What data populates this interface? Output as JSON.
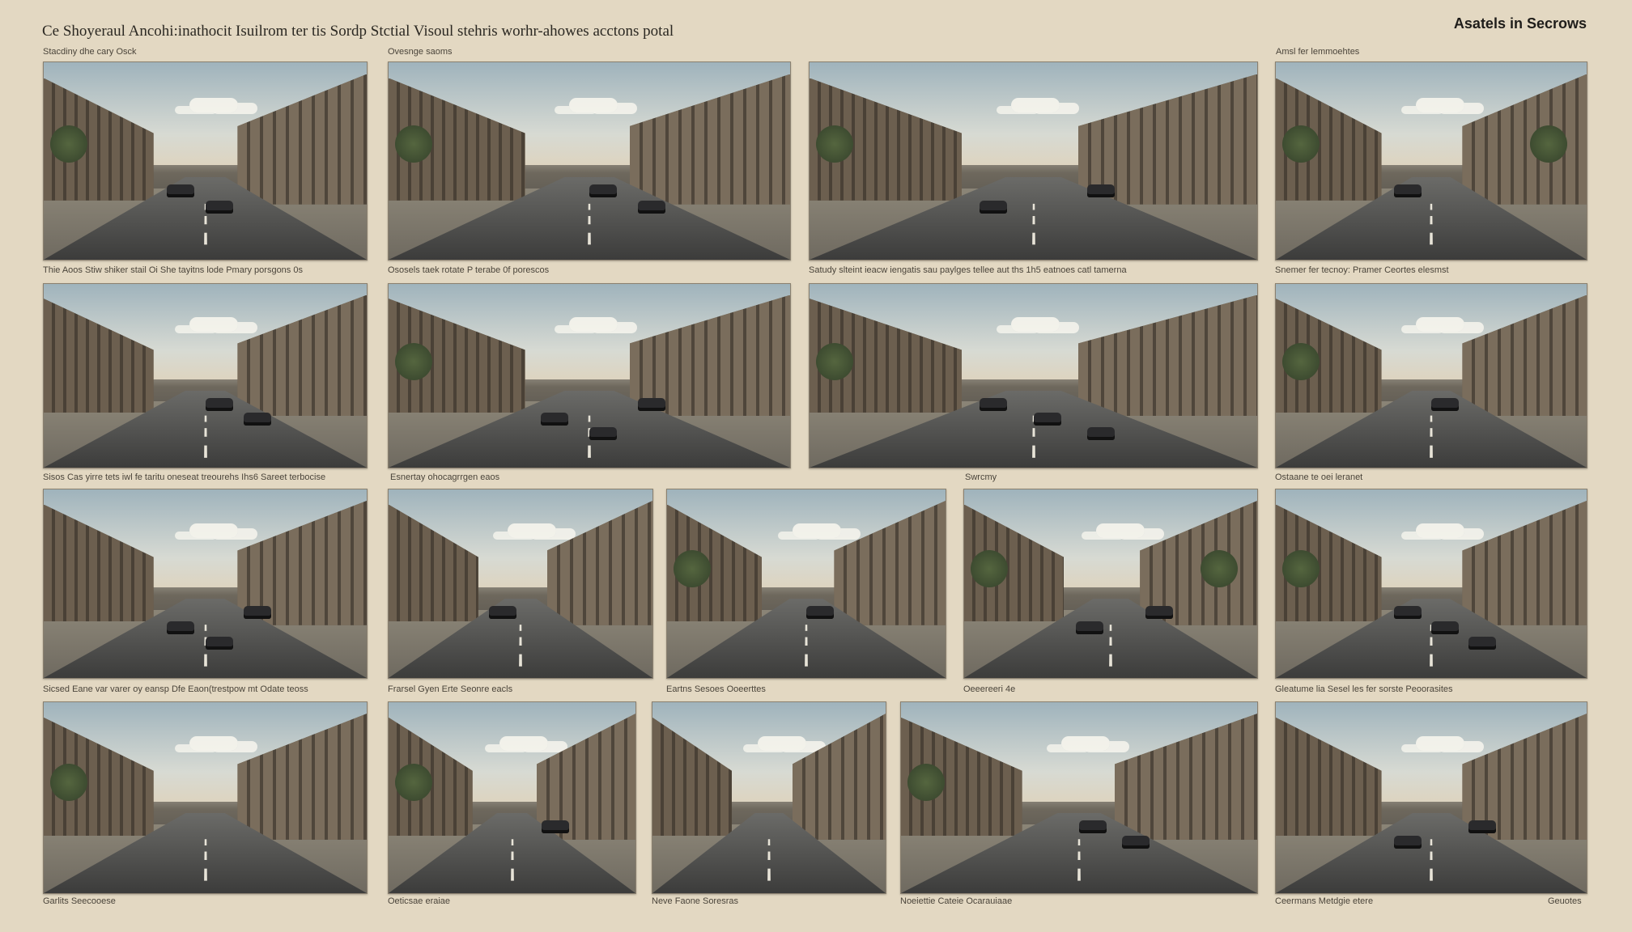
{
  "header": {
    "title": "Ce Shoyeraul Ancohi:inathocit Isuilrom ter tis Sordp Stctial Visoul stehris worhr-ahowes acctons potal",
    "brand": "Asatels in Secrows"
  },
  "captions": {
    "r1c1_top": "Stacdiny dhe cary Osck",
    "r1c2_top": "Ovesnge saoms",
    "r1c4_top": "Amsl fer lemmoehtes",
    "r1c1": "Thie Aoos Stiw shiker stail Oi She tayitns lode Pmary porsgons 0s",
    "r1c2": "Ososels taek rotate P terabe 0f porescos",
    "r1c3": "Satudy slteint ieacw iengatis sau paylges tellee aut ths 1h5 eatnoes catl tamerna",
    "r1c4": "Snemer fer tecnoy: Pramer Ceortes elesmst",
    "r2c1": "Sisos Cas yirre tets iwl fe taritu oneseat treourehs Ihs6 Sareet terbocise",
    "r2c2": "Esnertay ohocagrrgen eaos",
    "r2c3": "Swrcmy",
    "r2c4": "Ostaane te oei leranet",
    "r3c1": "Sicsed Eane var varer oy eansp Dfe Eaon(trestpow mt Odate teoss",
    "r3c2": "Frarsel Gyen Erte Seonre eacls",
    "r3c3": "Eartns Sesoes Ooeerttes",
    "r3c4": "Oeeereeri 4e",
    "r3c5": "Gleatume lia Sesel les fer sorste Peoorasites",
    "r4c1": "Garlits Seecooese",
    "r4c2": "Oeticsae eraiae",
    "r4c3": "Neve Faone Soresras",
    "r4c4": "Noeiettie Cateie Ocarauiaae",
    "r4c5": "Ceermans Metdgie etere",
    "r4c6": "Geuotes"
  },
  "photos": [
    {
      "name": "street-photo-r1c1",
      "cars": 2,
      "trees": 1
    },
    {
      "name": "street-photo-r1c2",
      "cars": 2,
      "trees": 1
    },
    {
      "name": "street-photo-r1c3",
      "cars": 2,
      "trees": 1
    },
    {
      "name": "street-photo-r1c4",
      "cars": 1,
      "trees": 2
    },
    {
      "name": "street-photo-r2c1",
      "cars": 2,
      "trees": 0
    },
    {
      "name": "street-photo-r2c2",
      "cars": 3,
      "trees": 1
    },
    {
      "name": "street-photo-r2c3",
      "cars": 3,
      "trees": 1
    },
    {
      "name": "street-photo-r2c4",
      "cars": 1,
      "trees": 1
    },
    {
      "name": "street-photo-r3c1",
      "cars": 3,
      "trees": 0
    },
    {
      "name": "street-photo-r3c2",
      "cars": 1,
      "trees": 0
    },
    {
      "name": "street-photo-r3c3",
      "cars": 1,
      "trees": 1
    },
    {
      "name": "street-photo-r3c4",
      "cars": 2,
      "trees": 2
    },
    {
      "name": "street-photo-r3c5",
      "cars": 3,
      "trees": 1
    },
    {
      "name": "street-photo-r4c1",
      "cars": 0,
      "trees": 1
    },
    {
      "name": "street-photo-r4c2",
      "cars": 1,
      "trees": 1
    },
    {
      "name": "street-photo-r4c3",
      "cars": 0,
      "trees": 0
    },
    {
      "name": "street-photo-r4c4",
      "cars": 2,
      "trees": 1
    },
    {
      "name": "street-photo-r4c5",
      "cars": 2,
      "trees": 0
    }
  ],
  "colors": {
    "background": "#e3d8c2",
    "frame": "#8a806f"
  }
}
